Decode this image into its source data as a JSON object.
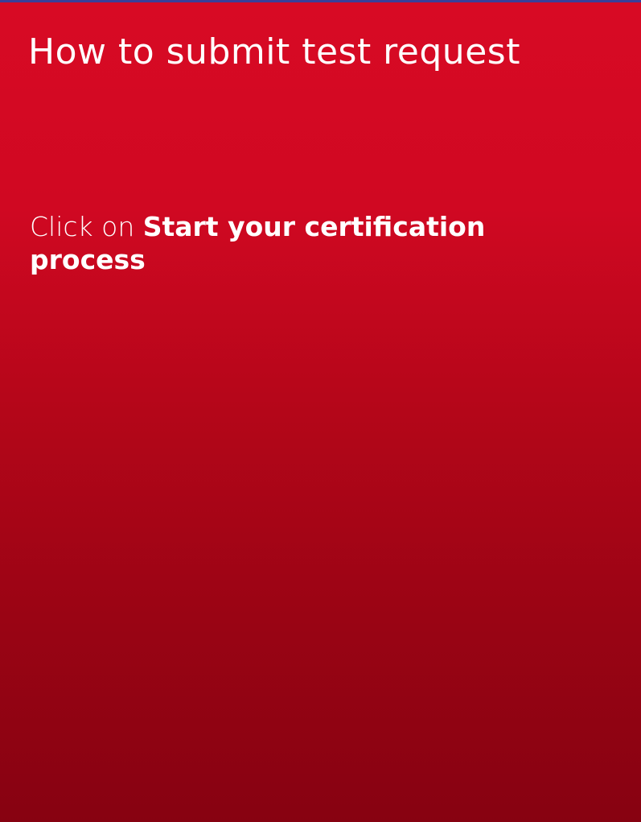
{
  "page": {
    "title": "How to submit test request",
    "instruction_prefix": "Click on ",
    "instruction_action": "Start your certification process"
  },
  "colors": {
    "gradient_top": "#d80a24",
    "gradient_bottom": "#870211",
    "top_border": "#3a3f9a",
    "text": "#ffffff"
  }
}
